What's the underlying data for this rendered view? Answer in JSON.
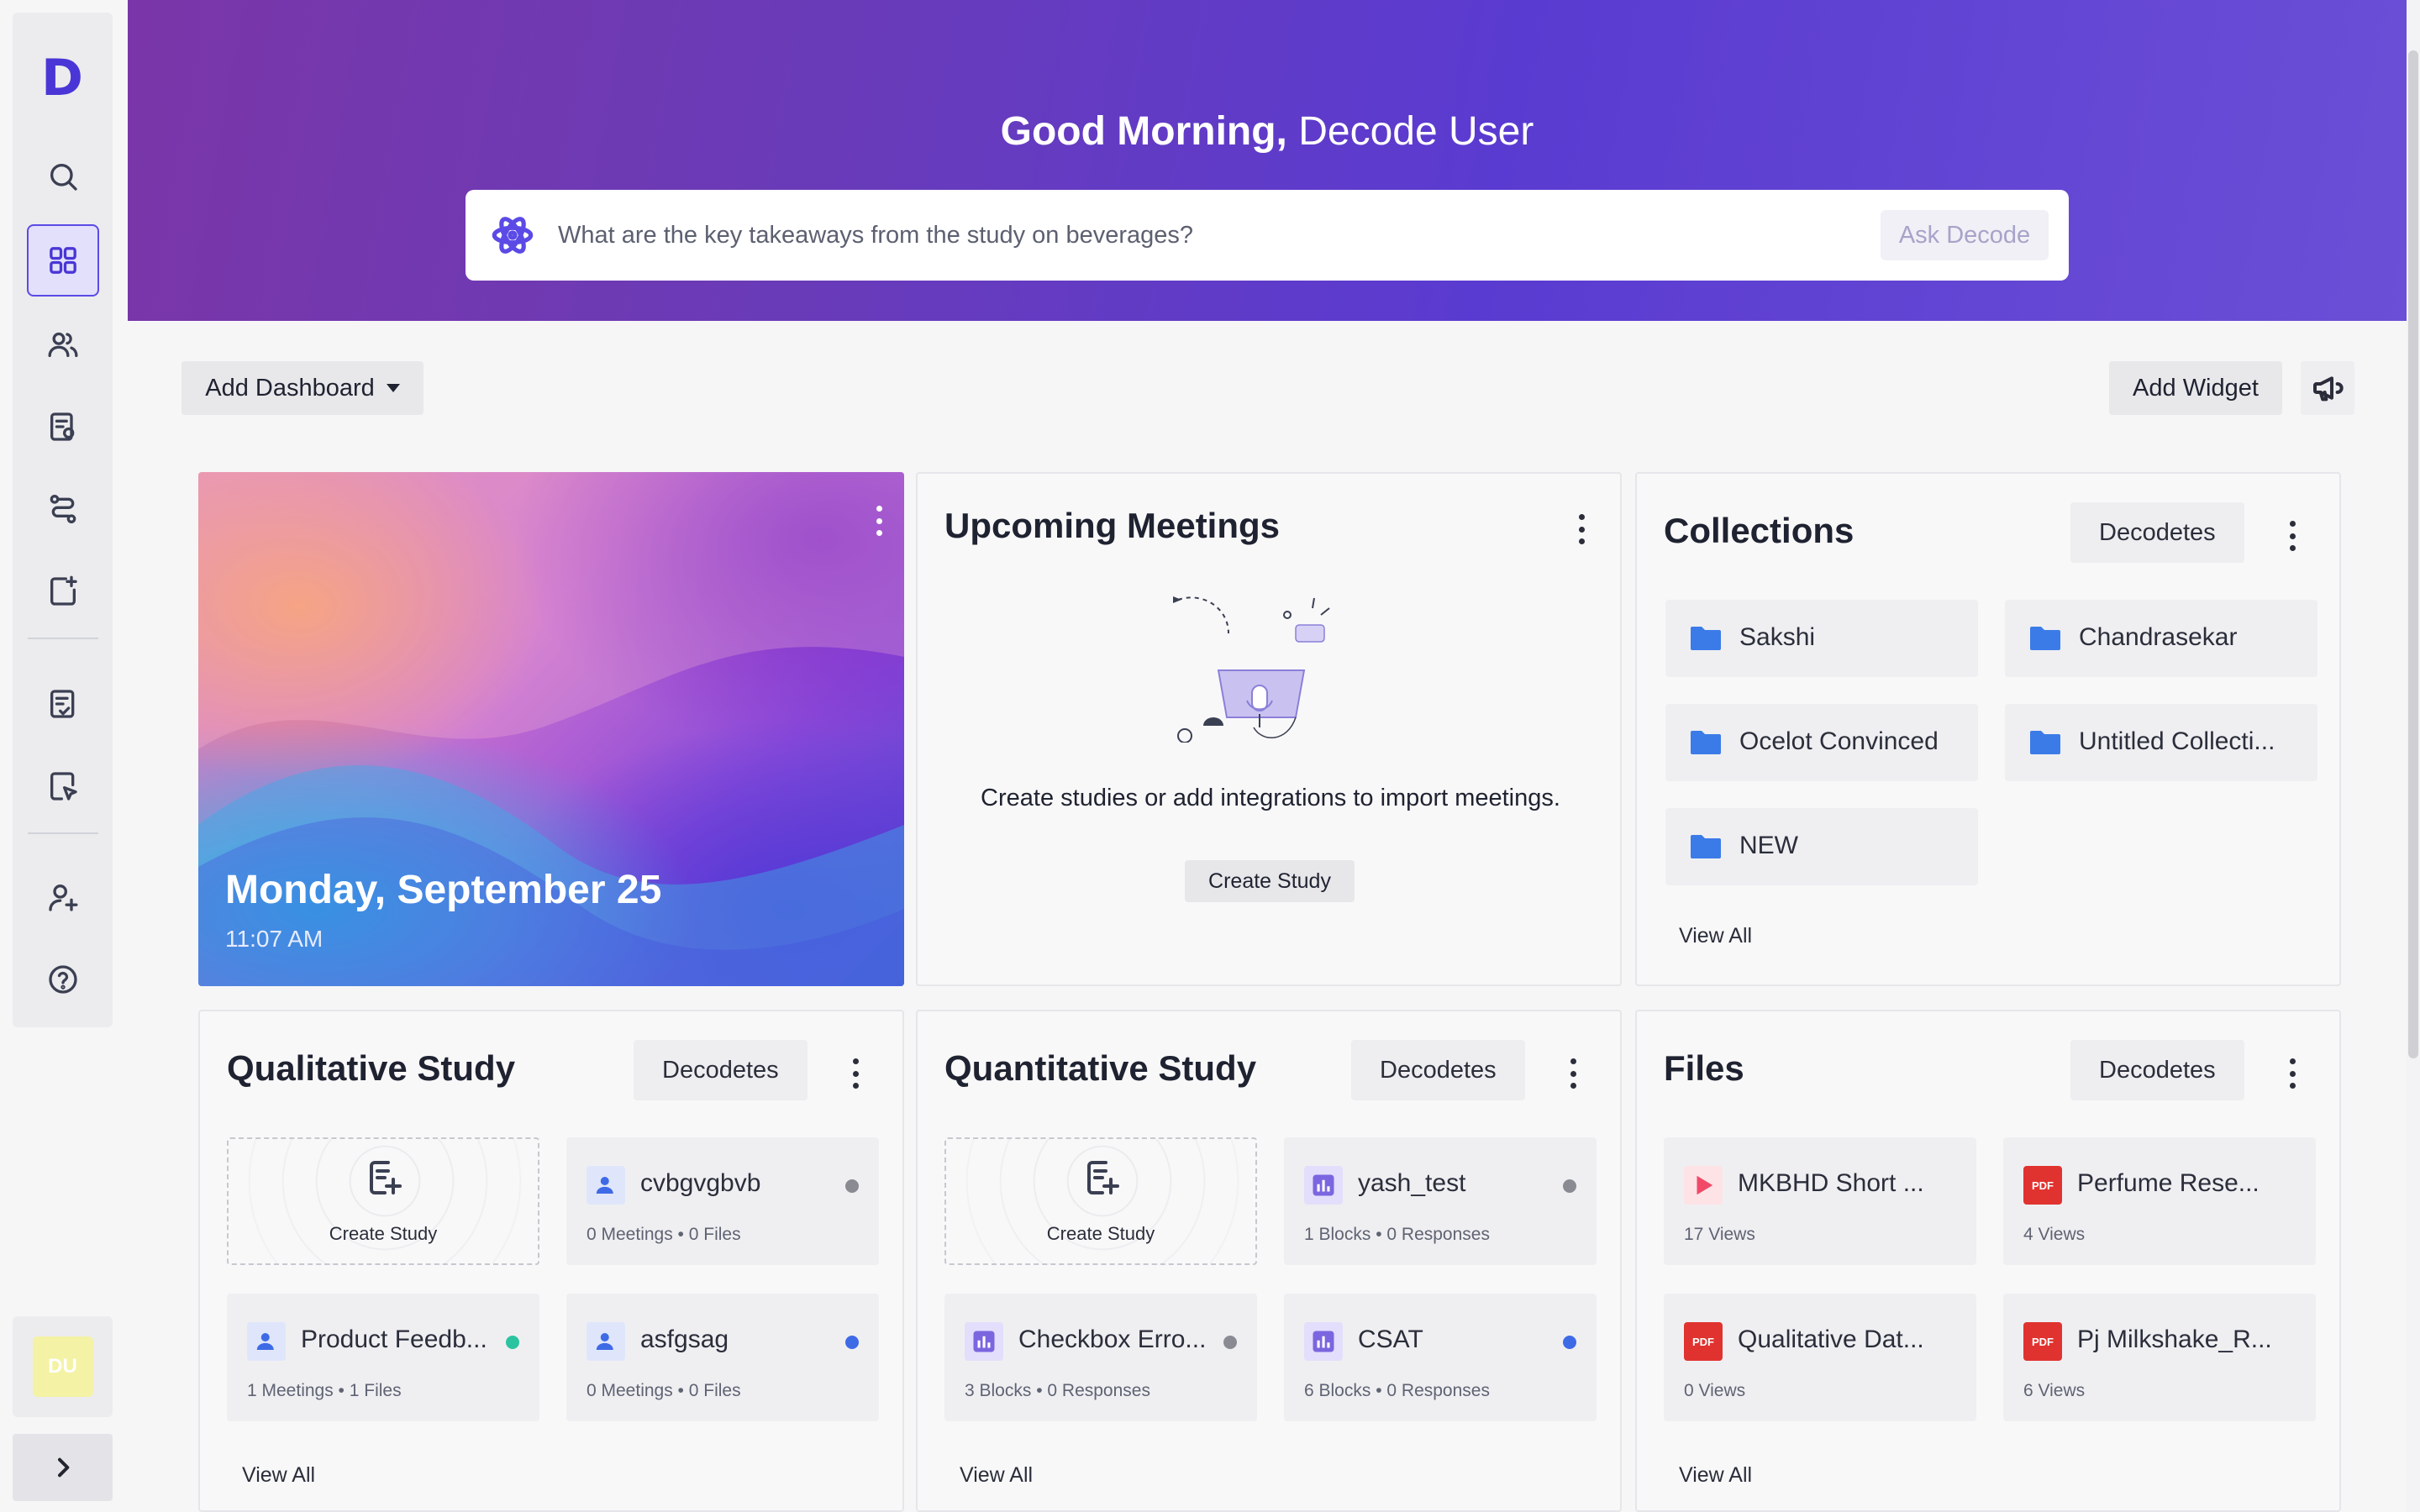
{
  "header": {
    "greeting_bold": "Good Morning,",
    "greeting_name": "Decode User",
    "ask_placeholder": "What are the key takeaways from the study on beverages?",
    "ask_button": "Ask Decode"
  },
  "sidebar": {
    "logo": "D",
    "avatar_initials": "DU",
    "items": [
      "search",
      "dashboard",
      "users",
      "studies",
      "workflows",
      "add-study",
      "notes",
      "reports",
      "add-user",
      "help"
    ]
  },
  "toolbar": {
    "add_dashboard": "Add Dashboard",
    "add_widget": "Add Widget"
  },
  "hero": {
    "date": "Monday, September 25",
    "time": "11:07 AM"
  },
  "upcoming": {
    "title": "Upcoming Meetings",
    "empty_text": "Create studies or add integrations to import meetings.",
    "button": "Create Study"
  },
  "collections": {
    "title": "Collections",
    "filter": "Decodetes",
    "items": [
      "Sakshi",
      "Chandrasekar",
      "Ocelot Convinced",
      "Untitled Collecti...",
      "NEW"
    ],
    "view_all": "View All"
  },
  "qualitative": {
    "title": "Qualitative Study",
    "filter": "Decodetes",
    "create_label": "Create Study",
    "items": [
      {
        "name": "cvbgvgbvb",
        "meta": "0 Meetings  •  0 Files",
        "status": "#8a8b92"
      },
      {
        "name": "Product Feedb...",
        "meta": "1 Meetings  •  1 Files",
        "status": "#2bc4a0"
      },
      {
        "name": "asfgsag",
        "meta": "0 Meetings  •  0 Files",
        "status": "#3f6ae6"
      }
    ],
    "view_all": "View All"
  },
  "quantitative": {
    "title": "Quantitative Study",
    "filter": "Decodetes",
    "create_label": "Create Study",
    "items": [
      {
        "name": "yash_test",
        "meta": "1 Blocks  •  0 Responses",
        "status": "#8a8b92"
      },
      {
        "name": "Checkbox Erro...",
        "meta": "3 Blocks  •  0 Responses",
        "status": "#8a8b92"
      },
      {
        "name": "CSAT",
        "meta": "6 Blocks  •  0 Responses",
        "status": "#3f6ae6"
      }
    ],
    "view_all": "View All"
  },
  "files": {
    "title": "Files",
    "filter": "Decodetes",
    "items": [
      {
        "name": "MKBHD Short ...",
        "meta": "17 Views",
        "type": "video"
      },
      {
        "name": "Perfume Rese...",
        "meta": "4 Views",
        "type": "pdf"
      },
      {
        "name": "Qualitative Dat...",
        "meta": "0 Views",
        "type": "pdf"
      },
      {
        "name": "Pj Milkshake_R...",
        "meta": "6 Views",
        "type": "pdf"
      }
    ],
    "pdf_label": "PDF",
    "view_all": "View All"
  },
  "colors": {
    "accent": "#5b4ae6",
    "folder": "#3b7be8",
    "pdf": "#e0332f"
  }
}
